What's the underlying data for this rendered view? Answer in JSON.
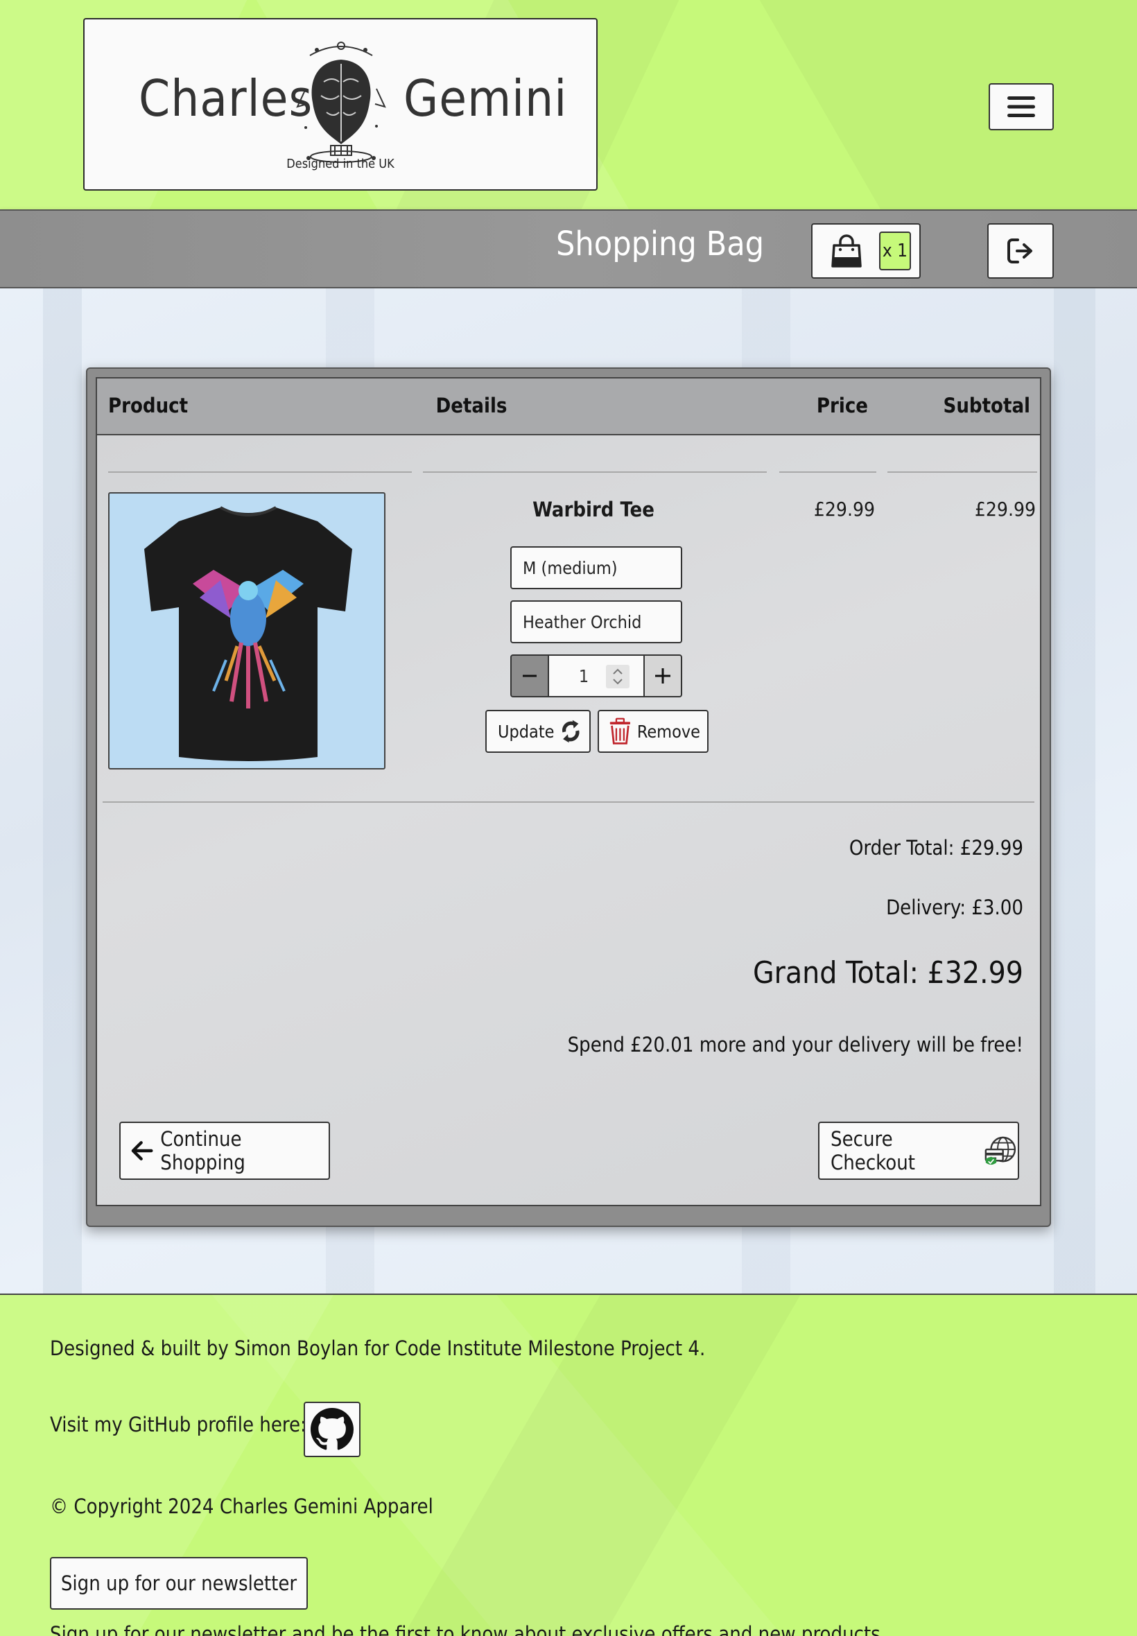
{
  "header": {
    "logo_left": "Charles",
    "logo_right": "Gemini",
    "tagline": "Designed in the UK",
    "menu_icon": "hamburger-icon"
  },
  "bar": {
    "title": "Shopping Bag",
    "bag_icon": "shopping-bag-icon",
    "bag_count": "x 1",
    "logout_icon": "logout-icon"
  },
  "table": {
    "headers": {
      "product": "Product",
      "details": "Details",
      "price": "Price",
      "subtotal": "Subtotal"
    },
    "item": {
      "name": "Warbird Tee",
      "price": "£29.99",
      "subtotal": "£29.99",
      "size": "M (medium)",
      "color": "Heather Orchid",
      "quantity": "1",
      "update_label": "Update",
      "remove_label": "Remove"
    }
  },
  "totals": {
    "order_total": "Order Total: £29.99",
    "delivery": "Delivery: £3.00",
    "grand_total": "Grand Total: £32.99",
    "free_delivery_msg": "Spend £20.01 more and your delivery will be free!"
  },
  "actions": {
    "continue_label": "Continue Shopping",
    "checkout_label": "Secure Checkout"
  },
  "footer": {
    "built_by": "Designed & built by Simon Boylan for Code Institute Milestone Project 4.",
    "github_text": "Visit my GitHub profile here:",
    "copyright": "© Copyright 2024 Charles Gemini Apparel",
    "newsletter_btn": "Sign up for our newsletter",
    "newsletter_text": "Sign up for our newsletter and be the first to know about exclusive offers and new products."
  },
  "colors": {
    "brand_green": "#c6f97a",
    "bar_grey": "#8e8e8e",
    "remove_red": "#c0262d"
  }
}
